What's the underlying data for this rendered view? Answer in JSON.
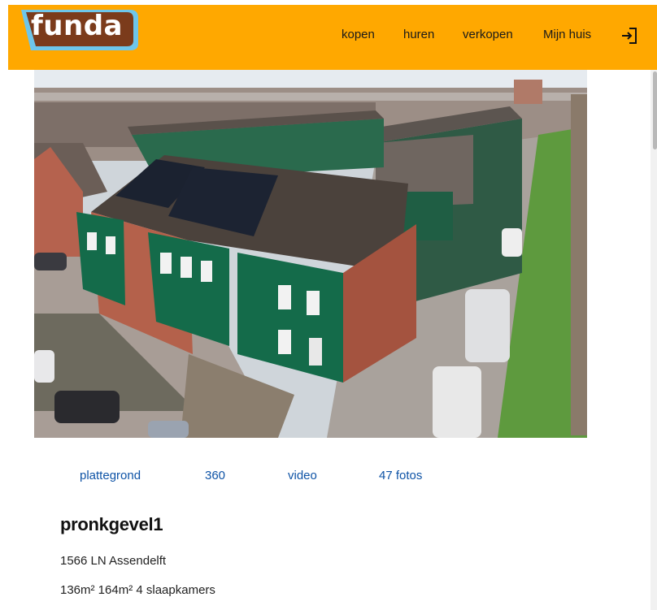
{
  "header": {
    "logo_text": "funda",
    "nav": [
      "kopen",
      "huren",
      "verkopen",
      "Mijn huis"
    ],
    "login_icon": "login-icon",
    "colors": {
      "header_bg": "#ffa800",
      "logo_blue": "#6ec6ea",
      "logo_brown": "#7b3b1b"
    }
  },
  "listing": {
    "media_links": [
      "plattegrond",
      "360",
      "video",
      "47 fotos"
    ],
    "title": "pronkgevel1",
    "address": "1566 LN Assendelft",
    "specs": "136m² 164m² 4 slaapkamers",
    "link_color": "#0e53a6"
  }
}
